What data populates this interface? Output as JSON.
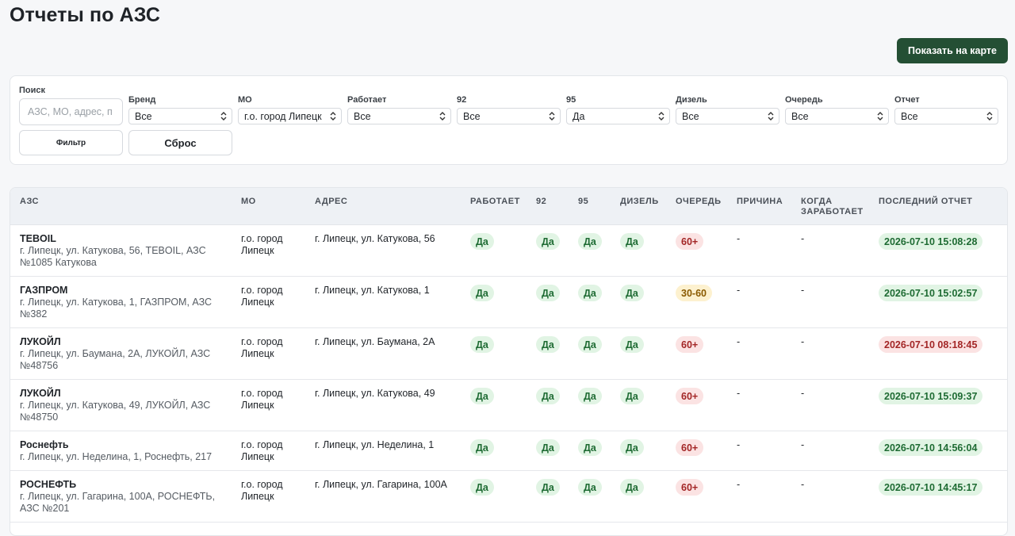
{
  "page": {
    "title": "Отчеты по АЗС"
  },
  "header": {
    "map_button": "Показать на карте"
  },
  "filters": {
    "search": {
      "label": "Поиск",
      "placeholder": "АЗС, МО, адрес, п"
    },
    "selects": [
      {
        "label": "Бренд",
        "value": "Все"
      },
      {
        "label": "МО",
        "value": "г.о. город Липецк"
      },
      {
        "label": "Работает",
        "value": "Все"
      },
      {
        "label": "92",
        "value": "Все"
      },
      {
        "label": "95",
        "value": "Да"
      },
      {
        "label": "Дизель",
        "value": "Все"
      },
      {
        "label": "Очередь",
        "value": "Все"
      },
      {
        "label": "Отчет",
        "value": "Все"
      }
    ],
    "filter_button": "Фильтр",
    "reset_button": "Сброс"
  },
  "table": {
    "columns": [
      "АЗС",
      "МО",
      "АДРЕС",
      "РАБОТАЕТ",
      "92",
      "95",
      "ДИЗЕЛЬ",
      "ОЧЕРЕДЬ",
      "ПРИЧИНА",
      "КОГДА ЗАРАБОТАЕТ",
      "ПОСЛЕДНИЙ ОТЧЕТ"
    ],
    "rows": [
      {
        "name": "TEBOIL",
        "details": "г. Липецк, ул. Катукова, 56, TEBOIL, АЗС №1085 Катукова",
        "mo": "г.о. город Липецк",
        "address": "г. Липецк, ул. Катукова, 56",
        "works": "Да",
        "f92": "Да",
        "f95": "Да",
        "diesel": "Да",
        "queue": "60+",
        "queue_color": "red",
        "reason": "-",
        "when": "-",
        "last": "2026-07-10 15:08:28",
        "last_color": "green"
      },
      {
        "name": "ГАЗПРОМ",
        "details": "г. Липецк, ул. Катукова, 1, ГАЗПРОМ, АЗС №382",
        "mo": "г.о. город Липецк",
        "address": "г. Липецк, ул. Катукова, 1",
        "works": "Да",
        "f92": "Да",
        "f95": "Да",
        "diesel": "Да",
        "queue": "30-60",
        "queue_color": "yellow",
        "reason": "-",
        "when": "-",
        "last": "2026-07-10 15:02:57",
        "last_color": "green"
      },
      {
        "name": "ЛУКОЙЛ",
        "details": "г. Липецк, ул. Баумана, 2А, ЛУКОЙЛ, АЗС №48756",
        "mo": "г.о. город Липецк",
        "address": "г. Липецк, ул. Баумана, 2А",
        "works": "Да",
        "f92": "Да",
        "f95": "Да",
        "diesel": "Да",
        "queue": "60+",
        "queue_color": "red",
        "reason": "-",
        "when": "-",
        "last": "2026-07-10 08:18:45",
        "last_color": "red"
      },
      {
        "name": "ЛУКОЙЛ",
        "details": "г. Липецк, ул. Катукова, 49, ЛУКОЙЛ, АЗС №48750",
        "mo": "г.о. город Липецк",
        "address": "г. Липецк, ул. Катукова, 49",
        "works": "Да",
        "f92": "Да",
        "f95": "Да",
        "diesel": "Да",
        "queue": "60+",
        "queue_color": "red",
        "reason": "-",
        "when": "-",
        "last": "2026-07-10 15:09:37",
        "last_color": "green"
      },
      {
        "name": "Роснефть",
        "details": "г. Липецк, ул. Неделина, 1, Роснефть, 217",
        "mo": "г.о. город Липецк",
        "address": "г. Липецк, ул. Неделина, 1",
        "works": "Да",
        "f92": "Да",
        "f95": "Да",
        "diesel": "Да",
        "queue": "60+",
        "queue_color": "red",
        "reason": "-",
        "when": "-",
        "last": "2026-07-10 14:56:04",
        "last_color": "green"
      },
      {
        "name": "РОСНЕФТЬ",
        "details": "г. Липецк, ул. Гагарина, 100А, РОСНЕФТЬ, АЗС №201",
        "mo": "г.о. город Липецк",
        "address": "г. Липецк, ул. Гагарина, 100А",
        "works": "Да",
        "f92": "Да",
        "f95": "Да",
        "diesel": "Да",
        "queue": "60+",
        "queue_color": "red",
        "reason": "-",
        "when": "-",
        "last": "2026-07-10 14:45:17",
        "last_color": "green"
      }
    ]
  },
  "colors": {
    "accent": "#244f34",
    "green_bg": "#e1f4e4",
    "red_bg": "#fbe3e3",
    "yellow_bg": "#fdf1cf"
  }
}
